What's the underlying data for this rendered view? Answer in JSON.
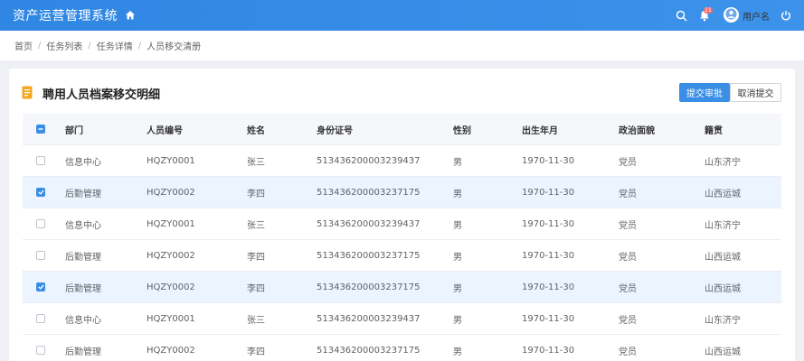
{
  "app": {
    "title": "资产运营管理系统",
    "username": "用户名",
    "notification_count": "11"
  },
  "colors": {
    "primary": "#3a8ee6",
    "badge": "#f56c6c",
    "title_icon": "#f5a623"
  },
  "breadcrumb": [
    "首页",
    "任务列表",
    "任务详情",
    "人员移交清册"
  ],
  "card": {
    "title": "聘用人员档案移交明细",
    "submit_label": "提交审批",
    "cancel_label": "取消提交"
  },
  "table": {
    "columns": [
      "部门",
      "人员编号",
      "姓名",
      "身份证号",
      "性别",
      "出生年月",
      "政治面貌",
      "籍贯"
    ],
    "rows": [
      {
        "checked": false,
        "cells": [
          "信息中心",
          "HQZY0001",
          "张三",
          "513436200003239437",
          "男",
          "1970-11-30",
          "党员",
          "山东济宁"
        ]
      },
      {
        "checked": true,
        "cells": [
          "后勤管理",
          "HQZY0002",
          "李四",
          "513436200003237175",
          "男",
          "1970-11-30",
          "党员",
          "山西运城"
        ]
      },
      {
        "checked": false,
        "cells": [
          "信息中心",
          "HQZY0001",
          "张三",
          "513436200003239437",
          "男",
          "1970-11-30",
          "党员",
          "山东济宁"
        ]
      },
      {
        "checked": false,
        "cells": [
          "后勤管理",
          "HQZY0002",
          "李四",
          "513436200003237175",
          "男",
          "1970-11-30",
          "党员",
          "山西运城"
        ]
      },
      {
        "checked": true,
        "cells": [
          "后勤管理",
          "HQZY0002",
          "李四",
          "513436200003237175",
          "男",
          "1970-11-30",
          "党员",
          "山西运城"
        ]
      },
      {
        "checked": false,
        "cells": [
          "信息中心",
          "HQZY0001",
          "张三",
          "513436200003239437",
          "男",
          "1970-11-30",
          "党员",
          "山东济宁"
        ]
      },
      {
        "checked": false,
        "cells": [
          "后勤管理",
          "HQZY0002",
          "李四",
          "513436200003237175",
          "男",
          "1970-11-30",
          "党员",
          "山西运城"
        ]
      }
    ]
  }
}
